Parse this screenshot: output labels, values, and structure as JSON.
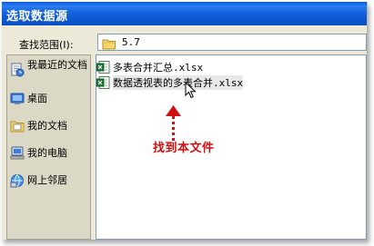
{
  "dialog": {
    "title": "选取数据源",
    "look_in_label": "查找范围(I):",
    "look_in_value": "5.7"
  },
  "places": [
    {
      "label": "我最近的文档",
      "icon": "recent-documents-icon"
    },
    {
      "label": "桌面",
      "icon": "desktop-icon"
    },
    {
      "label": "我的文档",
      "icon": "my-documents-icon"
    },
    {
      "label": "我的电脑",
      "icon": "my-computer-icon"
    },
    {
      "label": "网上邻居",
      "icon": "network-places-icon"
    }
  ],
  "files": [
    {
      "name_cn": "多表合并汇总",
      "name_ext": ".xlsx",
      "icon": "excel-file-icon"
    },
    {
      "name_cn": "数据透视表的多表合并",
      "name_ext": ".xlsx",
      "icon": "excel-file-icon"
    }
  ],
  "annotation": {
    "text": "找到本文件",
    "color": "#d01010"
  },
  "colors": {
    "title_bar": "#0a5de0",
    "dialog_bg": "#ece9d8",
    "places_bg": "#dcd8c6"
  }
}
